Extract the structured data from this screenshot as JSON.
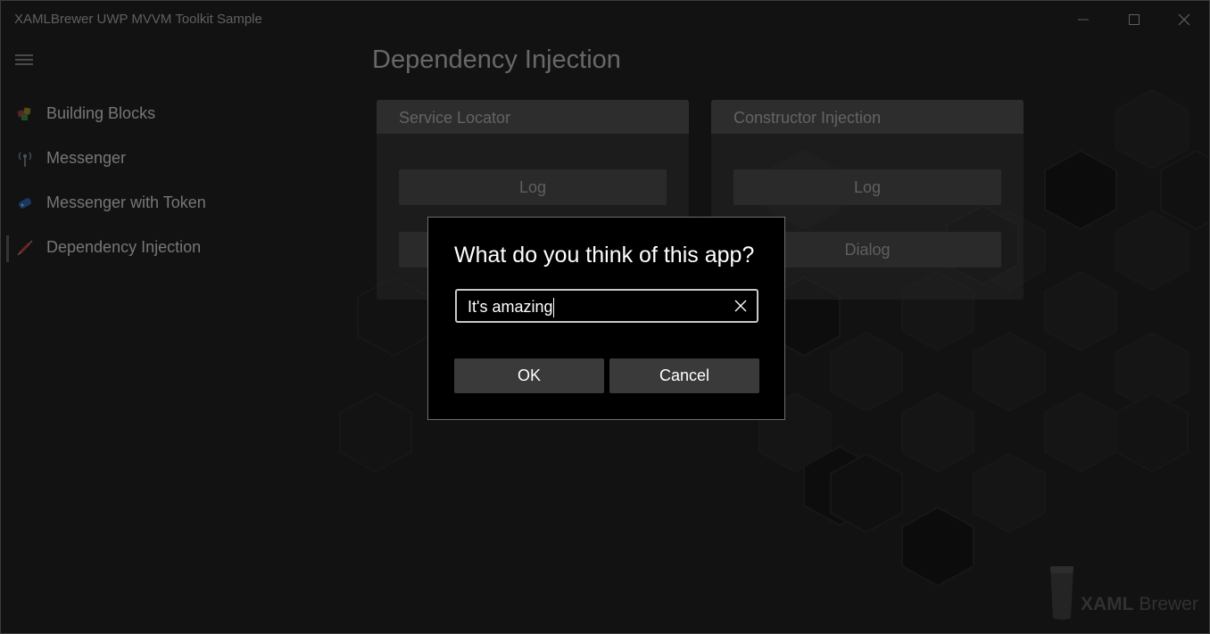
{
  "window": {
    "title": "XAMLBrewer UWP MVVM Toolkit Sample"
  },
  "sidebar": {
    "items": [
      {
        "label": "Building Blocks",
        "icon": "building-blocks-icon"
      },
      {
        "label": "Messenger",
        "icon": "antenna-icon"
      },
      {
        "label": "Messenger with Token",
        "icon": "token-icon"
      },
      {
        "label": "Dependency Injection",
        "icon": "syringe-icon",
        "selected": true
      }
    ]
  },
  "page": {
    "title": "Dependency Injection"
  },
  "panels": {
    "service_locator": {
      "title": "Service Locator",
      "log_label": "Log"
    },
    "constructor_injection": {
      "title": "Constructor Injection",
      "log_label": "Log",
      "dialog_label": "Dialog"
    }
  },
  "dialog": {
    "title": "What do you think of this app?",
    "input_value": "It's amazing",
    "ok_label": "OK",
    "cancel_label": "Cancel"
  },
  "logo": {
    "text_bold": "XAML",
    "text_regular": " Brewer"
  },
  "colors": {
    "background": "#1e1e1e",
    "dialog_background": "#000000",
    "button": "#3a3a3a"
  }
}
